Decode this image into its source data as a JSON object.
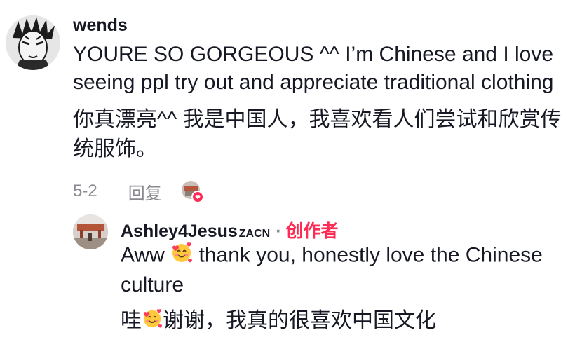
{
  "comment": {
    "username": "wends",
    "text": "YOURE SO GORGEOUS ^^ I’m Chinese and I love seeing ppl try out and appreciate traditional clothing",
    "translation": "你真漂亮^^ 我是中国人，我喜欢看人们尝试和欣赏传统服饰。",
    "date": "5-2",
    "reply_label": "回复"
  },
  "reply": {
    "username": "Ashley4Jesus",
    "username_suffix": "ZACN",
    "separator": "·",
    "creator_badge": "创作者",
    "text_before_emoji": "Aww",
    "text_after_emoji": "thank you, honestly love the Chinese culture",
    "translation_before_emoji": "哇",
    "translation_after_emoji": "谢谢，我真的很喜欢中国文化"
  },
  "colors": {
    "text": "#161823",
    "muted": "#8a8b91",
    "creator": "#fe2c55"
  },
  "icons": {
    "main_avatar": "manga-face-avatar",
    "reply_avatar": "photo-avatar",
    "liked_by_creator": "creator-heart-avatar",
    "emoji": "smiling-face-with-hearts"
  }
}
